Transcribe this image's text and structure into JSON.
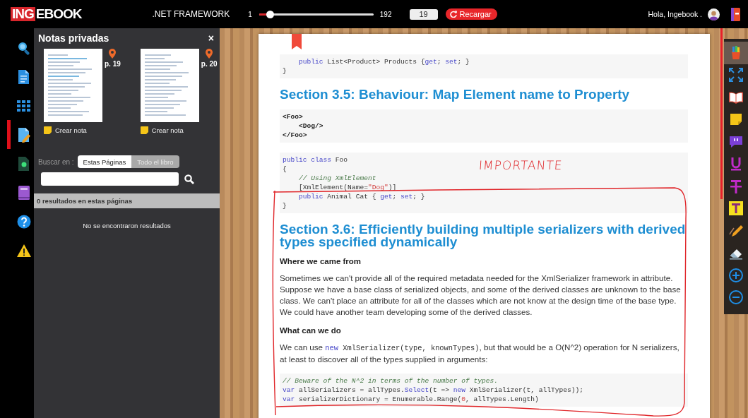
{
  "header": {
    "logo_highlight": "ING",
    "logo_rest": "EBOOK",
    "book_title": ".NET FRAMEWORK",
    "page_slider": {
      "min_label": "1",
      "max_label": "192",
      "level": 0.094
    },
    "page_field": {
      "value": "19"
    },
    "reload_button": {
      "label": "Recargar"
    },
    "greeting": "Hola, Ingebook ."
  },
  "left_rail": {
    "items": [
      {
        "kind": "search",
        "selected": false
      },
      {
        "kind": "document",
        "selected": false
      },
      {
        "kind": "grid",
        "selected": false
      },
      {
        "kind": "note",
        "selected": true
      },
      {
        "kind": "dark-document",
        "selected": false
      },
      {
        "kind": "book",
        "selected": false
      },
      {
        "kind": "help",
        "selected": false
      },
      {
        "kind": "warning",
        "selected": false
      }
    ]
  },
  "notes_panel": {
    "title": "Notas privadas",
    "close": "×",
    "pages": [
      {
        "page": "p. 19",
        "create_note": "Crear nota"
      },
      {
        "page": "p. 20",
        "create_note": "Crear nota"
      }
    ],
    "search_label": "Buscar en :",
    "scope_tabs": [
      {
        "label": "Estas Páginas",
        "selected": true
      },
      {
        "label": "Todo el libro",
        "selected": false
      }
    ],
    "results_header": "0 resultados en estas páginas",
    "empty_message": "No se encontraron resultados"
  },
  "document": {
    "annotation": "IMPORTANTE",
    "blocks": [
      {
        "kind": "code",
        "lines": [
          [
            {
              "t": "    public",
              "kind": "kw"
            },
            {
              "t": " List<Product> Products {",
              "kind": "plain"
            },
            {
              "t": "get",
              "kind": "kw"
            },
            {
              "t": "; ",
              "kind": "plain"
            },
            {
              "t": "set",
              "kind": "kw"
            },
            {
              "t": "; }",
              "kind": "plain"
            }
          ],
          [
            {
              "t": "}",
              "kind": "plain"
            }
          ]
        ]
      },
      {
        "kind": "heading",
        "text": "Section 3.5: Behaviour: Map Element name to Property"
      },
      {
        "kind": "code",
        "lines": [
          [
            {
              "t": "<Foo>",
              "kind": "tag"
            }
          ],
          [
            {
              "t": "    <Dog/>",
              "kind": "tag"
            }
          ],
          [
            {
              "t": "</Foo>",
              "kind": "tag"
            }
          ]
        ]
      },
      {
        "kind": "code",
        "lines": [
          [
            {
              "t": "public class",
              "kind": "kw"
            },
            {
              "t": " Foo",
              "kind": "plain"
            }
          ],
          [
            {
              "t": "{",
              "kind": "plain"
            }
          ],
          [
            {
              "t": "    // Using XmlElement",
              "kind": "comment"
            }
          ],
          [
            {
              "t": "    [XmlElement(Name=",
              "kind": "plain"
            },
            {
              "t": "\"Dog\"",
              "kind": "str"
            },
            {
              "t": ")]",
              "kind": "plain"
            }
          ],
          [
            {
              "t": "    public",
              "kind": "kw"
            },
            {
              "t": " Animal Cat { ",
              "kind": "plain"
            },
            {
              "t": "get",
              "kind": "kw"
            },
            {
              "t": "; ",
              "kind": "plain"
            },
            {
              "t": "set",
              "kind": "kw"
            },
            {
              "t": "; }",
              "kind": "plain"
            }
          ],
          [
            {
              "t": "}",
              "kind": "plain"
            }
          ]
        ]
      },
      {
        "kind": "heading",
        "text": "Section 3.6: Efficiently building multiple serializers with derived types specified dynamically"
      },
      {
        "kind": "subheading",
        "text": "Where we came from"
      },
      {
        "kind": "paragraph",
        "segments": [
          {
            "t": "Sometimes we can't provide all of the required metadata needed for the XmlSerializer framework in attribute. Suppose we have a base class of serialized objects, and some of the derived classes are unknown to the base class. We can't place an attribute for all of the classes which are not know at the design time of the base type. We could have another team developing some of the derived classes.",
            "kind": "text"
          }
        ]
      },
      {
        "kind": "subheading",
        "text": "What can we do"
      },
      {
        "kind": "paragraph",
        "segments": [
          {
            "t": "We can use ",
            "kind": "text"
          },
          {
            "t": "new",
            "kind": "kw"
          },
          {
            "t": " XmlSerializer(type, knownTypes)",
            "kind": "plain"
          },
          {
            "t": ", but that would be a O(N^2) operation for N serializers, at least to discover all of the types supplied in arguments:",
            "kind": "text"
          }
        ]
      },
      {
        "kind": "code",
        "lines": [
          [
            {
              "t": "// Beware of the N^2 in terms of the number of types.",
              "kind": "comment"
            }
          ],
          [
            {
              "t": "var",
              "kind": "kw"
            },
            {
              "t": " allSerializers = allTypes.",
              "kind": "plain"
            },
            {
              "t": "Select",
              "kind": "kw"
            },
            {
              "t": "(t => ",
              "kind": "plain"
            },
            {
              "t": "new",
              "kind": "kw"
            },
            {
              "t": " XmlSerializer(t, allTypes));",
              "kind": "plain"
            }
          ],
          [
            {
              "t": "var",
              "kind": "kw"
            },
            {
              "t": " serializerDictionary = Enumerable.Range(",
              "kind": "plain"
            },
            {
              "t": "0",
              "kind": "str"
            },
            {
              "t": ", allTypes.Length)",
              "kind": "plain"
            }
          ]
        ]
      }
    ]
  },
  "tools": {
    "items": [
      {
        "kind": "pens",
        "selected": true
      },
      {
        "kind": "fullscreen",
        "selected": false
      },
      {
        "kind": "book",
        "selected": false
      },
      {
        "kind": "sticky-note",
        "selected": false
      },
      {
        "kind": "quote",
        "selected": false
      },
      {
        "kind": "underline",
        "selected": false
      },
      {
        "kind": "strikethrough",
        "selected": false
      },
      {
        "kind": "text-highlight",
        "selected": false
      },
      {
        "kind": "pencil",
        "selected": false
      },
      {
        "kind": "eraser",
        "selected": false
      },
      {
        "kind": "zoom-in",
        "selected": false
      },
      {
        "kind": "zoom-out",
        "selected": false
      }
    ]
  }
}
